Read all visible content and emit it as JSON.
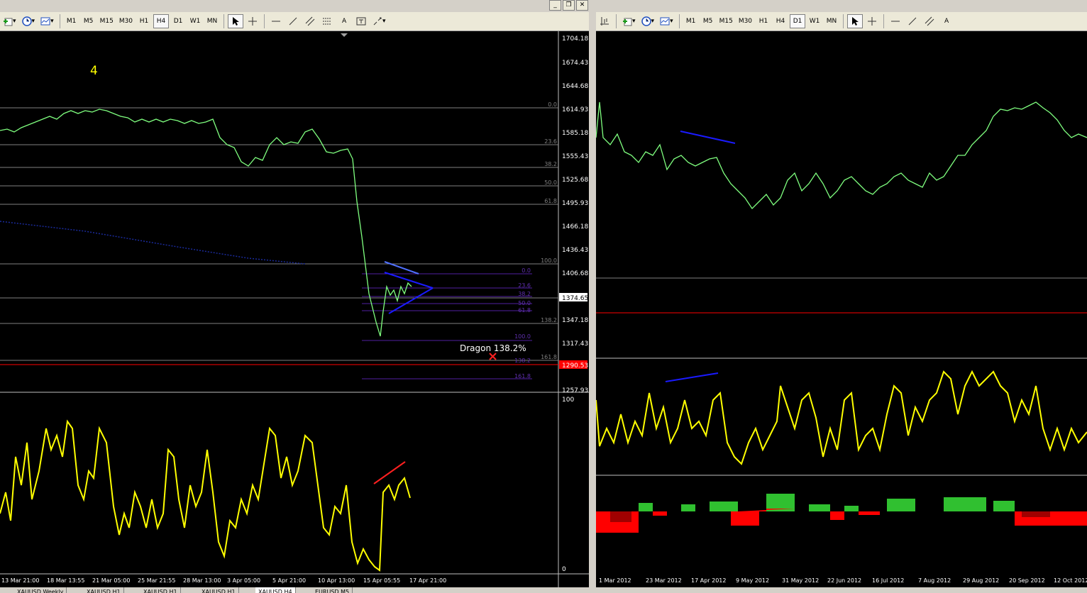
{
  "left_toolbar": {
    "timeframes": [
      "M1",
      "M5",
      "M15",
      "M30",
      "H1",
      "H4",
      "D1",
      "W1",
      "MN"
    ],
    "active": "H4",
    "text_tool": "A"
  },
  "right_toolbar": {
    "timeframes": [
      "M1",
      "M5",
      "M15",
      "M30",
      "H1",
      "H4",
      "D1",
      "W1",
      "MN"
    ],
    "active": "D1",
    "text_tool": "A"
  },
  "left_chart": {
    "label": "4",
    "price_ticks": [
      "1704.18",
      "1674.43",
      "1644.68",
      "1614.93",
      "1585.18",
      "1555.43",
      "1525.68",
      "1495.93",
      "1466.18",
      "1436.43",
      "1406.68",
      "1374.65",
      "1347.18",
      "1317.43",
      "1290.53",
      "1257.93"
    ],
    "current_price": "1374.65",
    "red_price": "1290.53",
    "fib_big": [
      "0.0",
      "23.6",
      "38.2",
      "50.0",
      "61.8",
      "100.0",
      "138.2",
      "161.8"
    ],
    "fib_small": [
      "0.0",
      "23.6",
      "38.2",
      "50.0",
      "61.8",
      "100.0",
      "138.2",
      "161.8"
    ],
    "dragon_label": "Dragon 138.2%",
    "indicator_scale": [
      "100",
      "0"
    ],
    "time_labels": [
      "13 Mar 21:00",
      "18 Mar 13:55",
      "21 Mar 05:00",
      "25 Mar 21:55",
      "28 Mar 13:00",
      "3 Apr 05:00",
      "5 Apr 21:00",
      "10 Apr 13:00",
      "15 Apr 05:55",
      "17 Apr 21:00"
    ],
    "colors": {
      "candles": "#7fff7f",
      "indicator": "#ffff00",
      "red": "#ff0000",
      "blue": "#1a1aff"
    }
  },
  "right_chart": {
    "time_labels": [
      "1 Mar 2012",
      "23 Mar 2012",
      "17 Apr 2012",
      "9 May 2012",
      "31 May 2012",
      "22 Jun 2012",
      "16 Jul 2012",
      "7 Aug 2012",
      "29 Aug 2012",
      "20 Sep 2012",
      "12 Oct 2012"
    ]
  },
  "tabs": [
    "XAUUSD,Weekly",
    "XAUUSD,H1",
    "XAUUSD,H1",
    "XAUUSD,H1",
    "XAUUSD,H4",
    "EURUSD,M5"
  ],
  "active_tab": "XAUUSD,H4"
}
